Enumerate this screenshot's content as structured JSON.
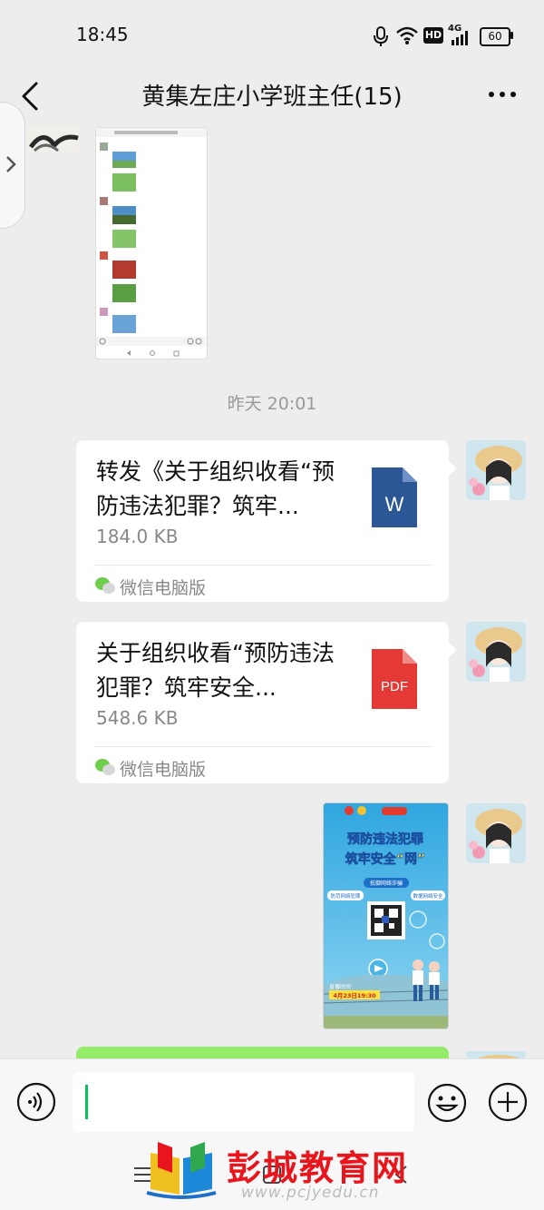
{
  "status_bar": {
    "time": "18:45",
    "network_badge": "HD",
    "signal_label": "4G",
    "battery": "60"
  },
  "header": {
    "title": "黄集左庄小学班主任(15)"
  },
  "chat": {
    "timestamp": "昨天 20:01",
    "messages": [
      {
        "type": "file",
        "file_name": "转发《关于组织收看“预防违法犯罪？筑牢...",
        "size": "184.0 KB",
        "source": "微信电脑版",
        "icon": "word-icon",
        "icon_letter": "W",
        "icon_color": "#2b5797"
      },
      {
        "type": "file",
        "file_name": "关于组织收看“预防违法犯罪？筑牢安全...",
        "size": "548.6 KB",
        "source": "微信电脑版",
        "icon": "pdf-icon",
        "icon_letter": "PDF",
        "icon_color": "#e53935"
      },
      {
        "type": "image",
        "poster": {
          "headline_line1": "预防违法犯罪",
          "headline_line2": "筑牢安全“网”",
          "tag_left": "防范网络犯罪",
          "tag_top": "抵御网络诈骗",
          "tag_right": "数据网络安全",
          "live_time": "4月23日19:30",
          "live_label": "直播时间"
        }
      }
    ]
  },
  "watermark": {
    "text": "彭城教育网",
    "url": "www.pcjyedu.cn"
  },
  "colors": {
    "accent": "#07c160",
    "sent_bubble": "#95ec69",
    "background": "#ededed"
  }
}
